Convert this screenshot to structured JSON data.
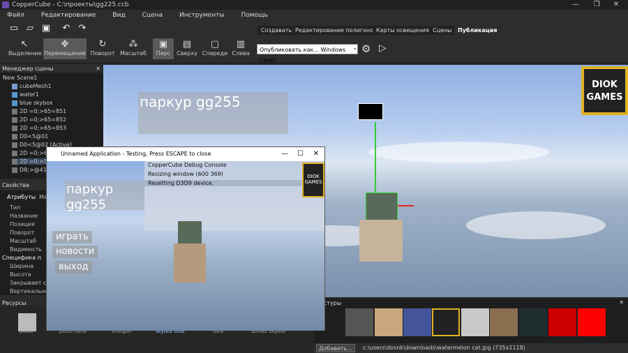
{
  "window": {
    "title": "CopperCube - C:\\проекты\\gg225.ccb",
    "minimize": "—",
    "maximize": "❐",
    "close": "✕"
  },
  "menu": [
    "Файл",
    "Редактирование",
    "Вид",
    "Сцена",
    "Инструменты",
    "Помощь"
  ],
  "toolbar": {
    "tools": [
      "Выделение",
      "Перемещение",
      "Поворот",
      "Масштаб",
      "Перс",
      "Сверху",
      "Спереди",
      "Слева"
    ],
    "mode_tabs": [
      "Создавать",
      "Редактирование полигонов",
      "Карты освещения",
      "Сцены",
      "Публикация"
    ],
    "publish_select": "Опубликовать как... Windows (.exe)"
  },
  "scene_manager": {
    "title": "Менеджер сцены",
    "items": [
      "New Scene1",
      "cubeMesh1",
      "water1",
      "blue skybox",
      "2D =0;>65=851",
      "2D =0;>65=852",
      "2D =0;>65=853",
      "D0<5@01",
      "D0<5@02 [Active]",
      "2D =0;>65",
      "2D =0;>55",
      "D8;>@41"
    ]
  },
  "properties": {
    "title": "Свойства",
    "tabs": [
      "Атрибуты",
      "Ма"
    ],
    "rows": [
      "Тип",
      "Название",
      "Позиция",
      "Поворот",
      "Масштаб",
      "Видимость"
    ],
    "section": "Специфика п",
    "rows2": [
      "Ширина",
      "Высота",
      "Закрывает сцен",
      "Вертикально"
    ]
  },
  "resources": {
    "title": "Ресурсы",
    "labels": [
      "pistol",
      "pistol hand",
      "shotgun",
      "skybox blue",
      "sora",
      "sunset skybox"
    ]
  },
  "viewport": {
    "title_text": "паркур gg255",
    "logo_line1": "DIOK",
    "logo_line2": "GAMES"
  },
  "test_app": {
    "title": "Unnamed Application - Testing, Press ESCAPE to close",
    "title_text": "паркур gg255",
    "console": [
      "CopperCube Debug Console",
      "Resizing window (600 369)",
      "Resetting D3D9 device."
    ],
    "buttons": [
      "играть",
      "новости",
      "выход"
    ],
    "logo": "DIOK GAMES"
  },
  "textures": {
    "title": "стуры"
  },
  "status": {
    "add_button": "Добавить...",
    "path": "c:\\users\\dosnk\\downloads\\watermelon cat.jpg (735x1118)"
  },
  "colors": {
    "accent": "#e1b226",
    "selected_tool": "#5a5a5a"
  }
}
